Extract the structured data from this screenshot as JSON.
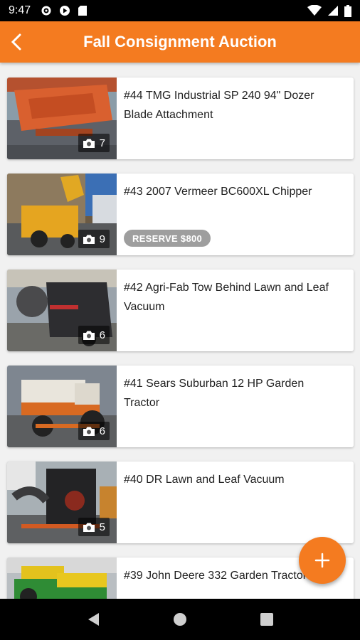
{
  "status": {
    "time": "9:47"
  },
  "header": {
    "title": "Fall Consignment Auction"
  },
  "colors": {
    "accent": "#f47b20",
    "badge": "#9e9e9e"
  },
  "items": [
    {
      "title": "#44 TMG Industrial SP 240 94\" Dozer Blade Attachment",
      "photos": "7",
      "badge": ""
    },
    {
      "title": "#43 2007 Vermeer BC600XL Chipper",
      "photos": "9",
      "badge": "RESERVE $800"
    },
    {
      "title": "#42 Agri-Fab Tow Behind Lawn and Leaf Vacuum",
      "photos": "6",
      "badge": ""
    },
    {
      "title": "#41 Sears Suburban 12 HP Garden Tractor",
      "photos": "6",
      "badge": ""
    },
    {
      "title": "#40 DR Lawn and Leaf Vacuum",
      "photos": "5",
      "badge": ""
    },
    {
      "title": "#39 John Deere 332 Garden Tractor",
      "photos": "",
      "badge": ""
    }
  ],
  "fab": {
    "icon": "plus-icon"
  }
}
